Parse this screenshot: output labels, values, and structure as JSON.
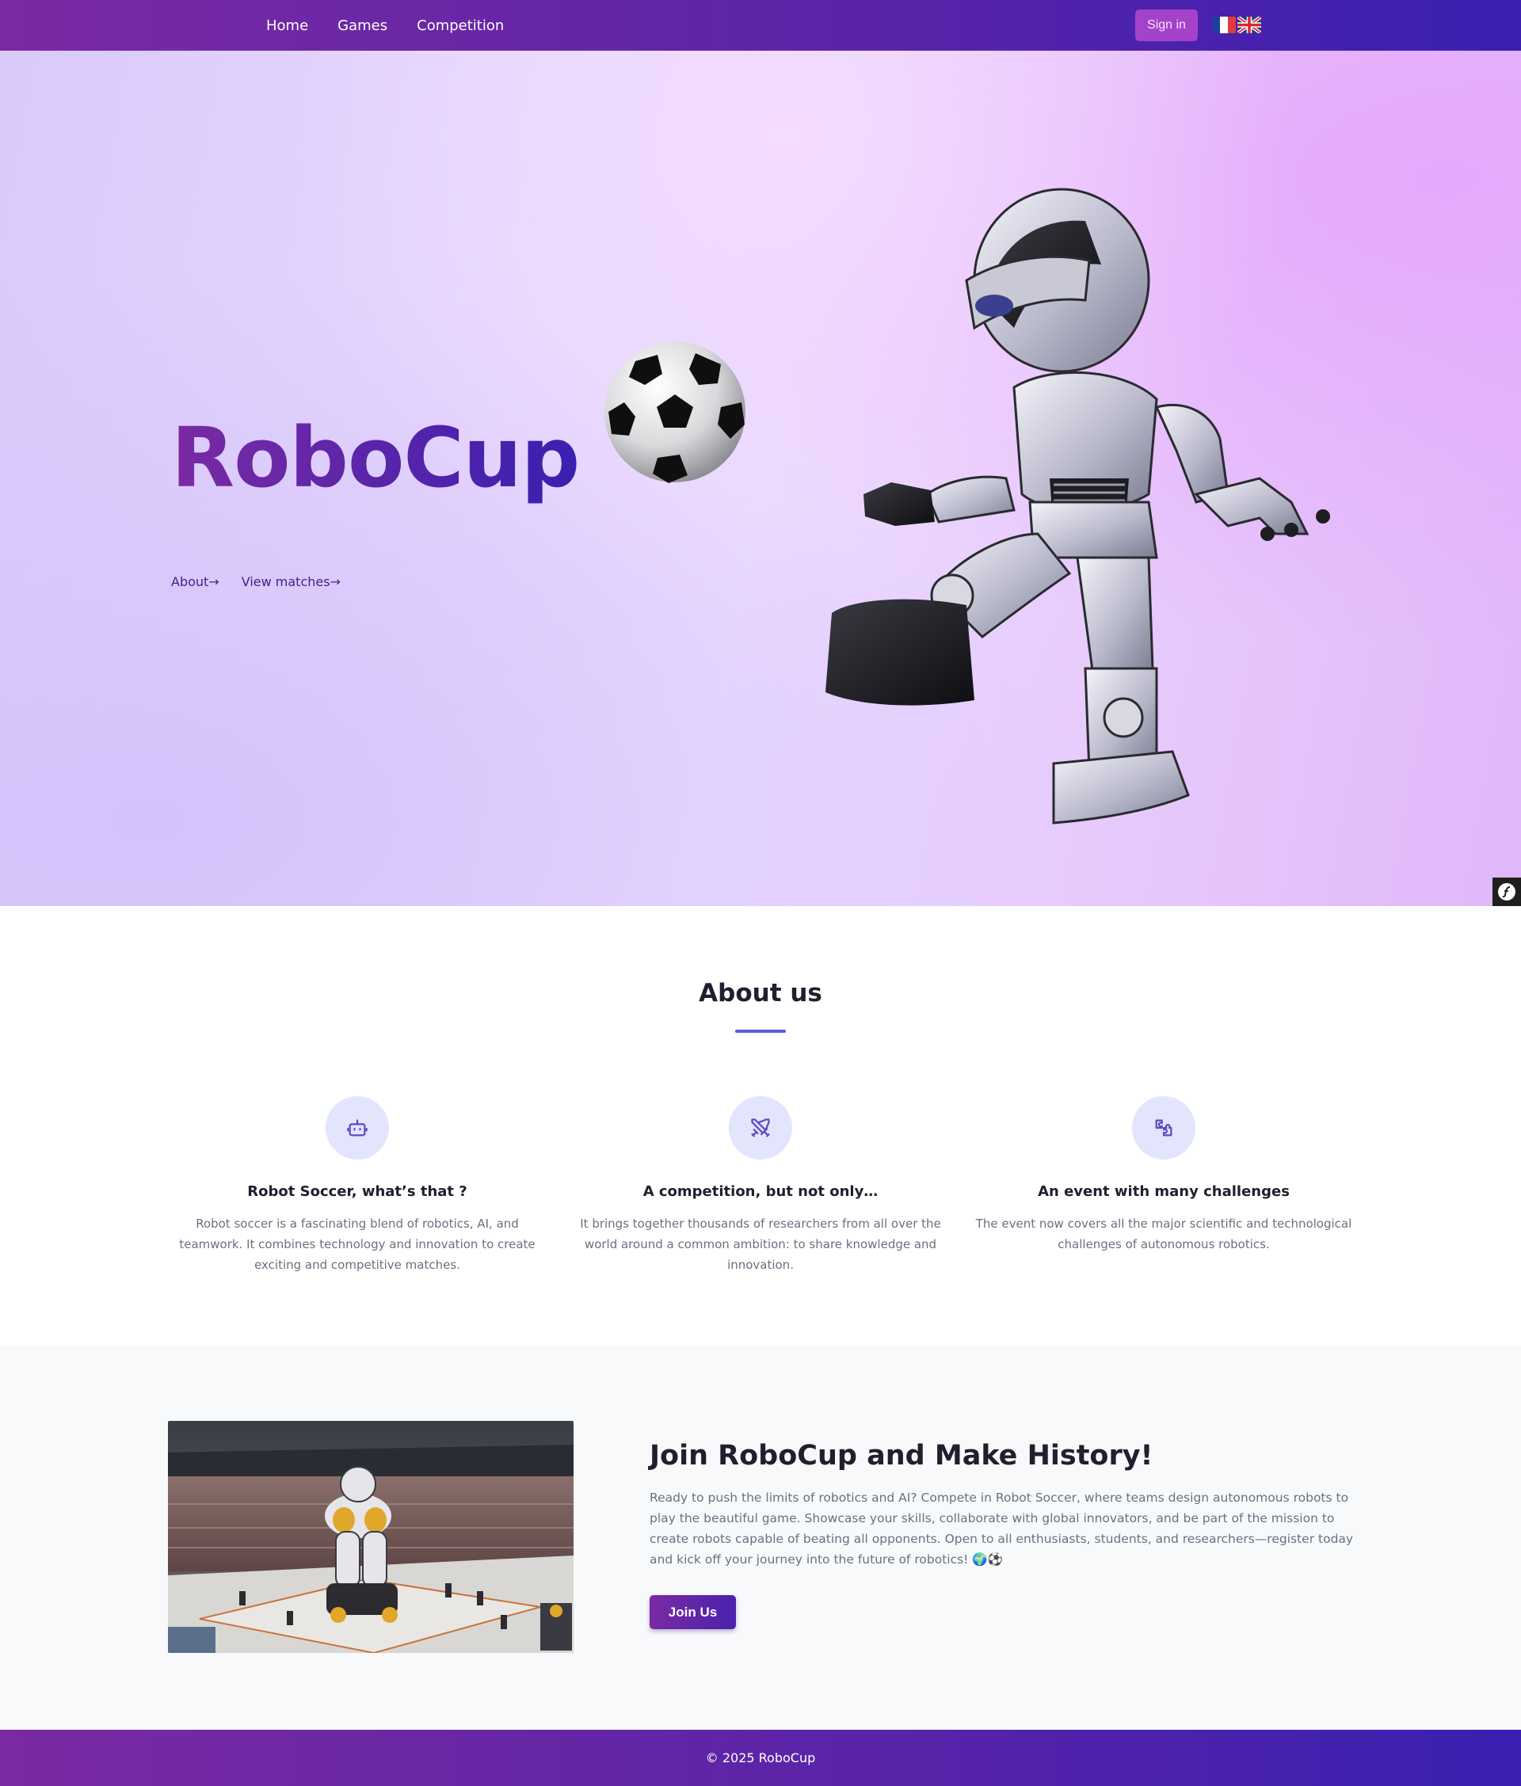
{
  "nav": {
    "links": [
      {
        "label": "Home"
      },
      {
        "label": "Games"
      },
      {
        "label": "Competition"
      }
    ],
    "signin_label": "Sign in",
    "flags": [
      "french-flag-icon",
      "uk-flag-icon"
    ]
  },
  "hero": {
    "title": "RoboCup",
    "links": [
      {
        "label": "About→"
      },
      {
        "label": "View matches→"
      }
    ]
  },
  "about": {
    "title": "About us",
    "features": [
      {
        "icon": "robot-icon",
        "title": "Robot Soccer, what’s that ?",
        "text": "Robot soccer is a fascinating blend of robotics, AI, and teamwork. It combines technology and innovation to create exciting and competitive matches."
      },
      {
        "icon": "crossed-swords-icon",
        "title": "A competition, but not only…",
        "text": "It brings together thousands of researchers from all over the world around a common ambition: to share knowledge and innovation."
      },
      {
        "icon": "puzzle-icon",
        "title": "An event with many challenges",
        "text": "The event now covers all the major scientific and technological challenges of autonomous robotics."
      }
    ]
  },
  "join": {
    "title": "Join RoboCup and Make History!",
    "text": "Ready to push the limits of robotics and AI? Compete in Robot Soccer, where teams design autonomous robots to play the beautiful game. Showcase your skills, collaborate with global innovators, and be part of the mission to create robots capable of beating all opponents. Open to all enthusiasts, students, and researchers—register today and kick off your journey into the future of robotics! 🌍⚽",
    "button_label": "Join Us"
  },
  "footer": {
    "text": "© 2025 RoboCup"
  },
  "colors": {
    "brand_purple": "#7a2aa3",
    "brand_indigo": "#3a1fb0",
    "signin_bg": "#a442c9",
    "accent_underline": "#5f5ad6",
    "icon_circle": "#e3e5fd"
  }
}
